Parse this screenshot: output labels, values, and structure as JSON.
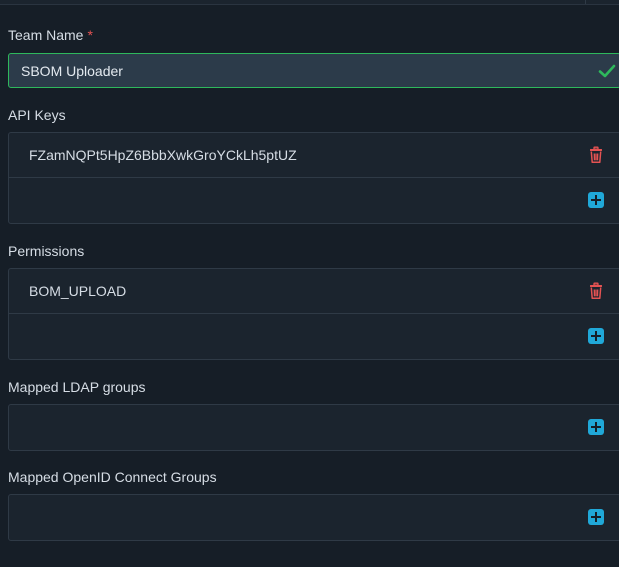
{
  "team_name": {
    "label": "Team Name",
    "required_marker": "*",
    "value": "SBOM Uploader"
  },
  "api_keys": {
    "label": "API Keys",
    "items": [
      "FZamNQPt5HpZ6BbbXwkGroYCkLh5ptUZ"
    ]
  },
  "permissions": {
    "label": "Permissions",
    "items": [
      "BOM_UPLOAD"
    ]
  },
  "ldap_groups": {
    "label": "Mapped LDAP groups",
    "items": []
  },
  "oidc_groups": {
    "label": "Mapped OpenID Connect Groups",
    "items": []
  },
  "icons": {
    "valid": "check-icon",
    "remove": "trash-icon",
    "add": "plus-square-icon"
  },
  "colors": {
    "background": "#161e27",
    "panel": "#1b242e",
    "border": "#2f3a46",
    "valid": "#2eb85c",
    "danger": "#e55353",
    "accent": "#20a8d8"
  }
}
